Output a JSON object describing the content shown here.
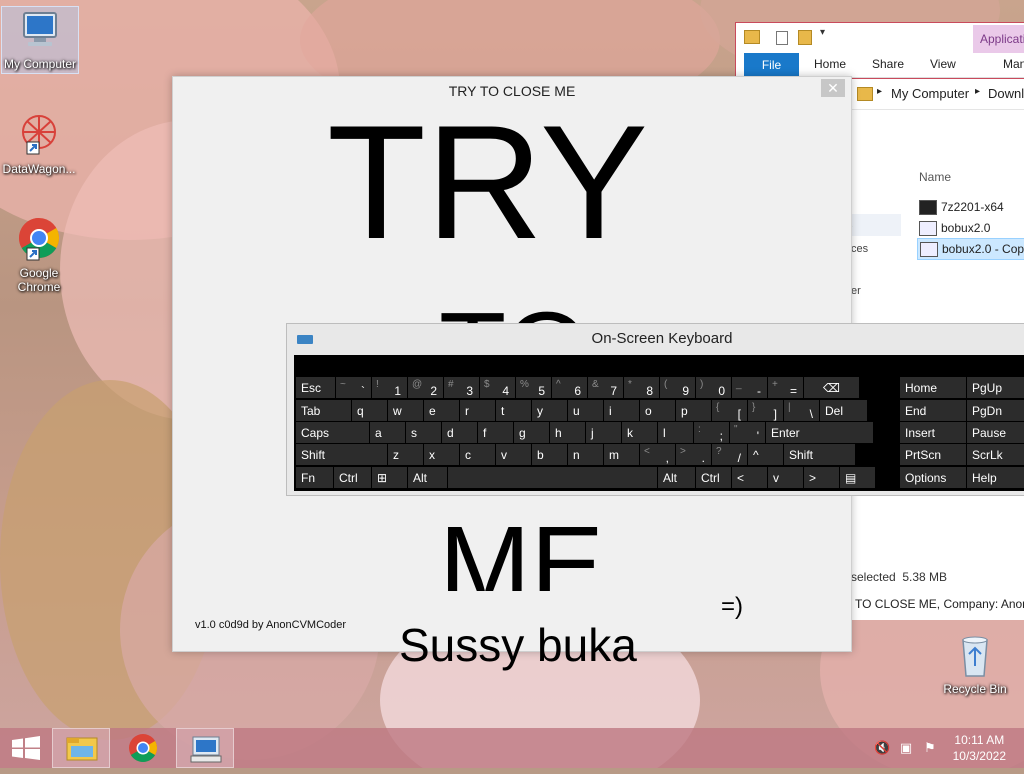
{
  "desktop": {
    "icons": [
      {
        "label": "My Computer",
        "icon": "computer-icon"
      },
      {
        "label": "DataWagon...",
        "icon": "datawagon-icon"
      },
      {
        "label": "Google Chrome",
        "icon": "chrome-icon"
      },
      {
        "label": "Recycle Bin",
        "icon": "recycle-bin-icon"
      }
    ]
  },
  "explorer": {
    "ribbon_tabs": [
      "File",
      "Home",
      "Share",
      "View",
      "Man"
    ],
    "app_tools": "Applicatio",
    "address": [
      "My Computer",
      "Downlo"
    ],
    "column_header": "Name",
    "files": [
      "7z2201-x64",
      "bobux2.0",
      "bobux2.0 - Copy"
    ],
    "nav_fragments": [
      "s",
      "ces",
      "er"
    ],
    "status": "selected  5.38 MB",
    "bottom_text": "TO CLOSE ME, Company: AnonC"
  },
  "prank": {
    "window_title": "TRY TO CLOSE ME",
    "line1": "TRY",
    "line2": "TO",
    "line3": "ME",
    "smiley": "=)",
    "subtitle": "Sussy buka",
    "credit": "v1.0 c0d9d by AnonCVMCoder"
  },
  "osk": {
    "title": "On-Screen Keyboard",
    "row1": [
      {
        "p": "Esc"
      },
      {
        "s": "~",
        "p": "`"
      },
      {
        "s": "!",
        "p": "1"
      },
      {
        "s": "@",
        "p": "2"
      },
      {
        "s": "#",
        "p": "3"
      },
      {
        "s": "$",
        "p": "4"
      },
      {
        "s": "%",
        "p": "5"
      },
      {
        "s": "^",
        "p": "6"
      },
      {
        "s": "&",
        "p": "7"
      },
      {
        "s": "*",
        "p": "8"
      },
      {
        "s": "(",
        "p": "9"
      },
      {
        "s": ")",
        "p": "0"
      },
      {
        "s": "_",
        "p": "-"
      },
      {
        "s": "+",
        "p": "="
      },
      {
        "p": "⌫"
      }
    ],
    "row2": [
      {
        "p": "Tab"
      },
      {
        "p": "q"
      },
      {
        "p": "w"
      },
      {
        "p": "e"
      },
      {
        "p": "r"
      },
      {
        "p": "t"
      },
      {
        "p": "y"
      },
      {
        "p": "u"
      },
      {
        "p": "i"
      },
      {
        "p": "o"
      },
      {
        "p": "p"
      },
      {
        "s": "{",
        "p": "["
      },
      {
        "s": "}",
        "p": "]"
      },
      {
        "s": "|",
        "p": "\\"
      },
      {
        "p": "Del"
      }
    ],
    "row3": [
      {
        "p": "Caps"
      },
      {
        "p": "a"
      },
      {
        "p": "s"
      },
      {
        "p": "d"
      },
      {
        "p": "f"
      },
      {
        "p": "g"
      },
      {
        "p": "h"
      },
      {
        "p": "j"
      },
      {
        "p": "k"
      },
      {
        "p": "l"
      },
      {
        "s": ":",
        "p": ";"
      },
      {
        "s": "\"",
        "p": "'"
      },
      {
        "p": "Enter"
      }
    ],
    "row4": [
      {
        "p": "Shift"
      },
      {
        "p": "z"
      },
      {
        "p": "x"
      },
      {
        "p": "c"
      },
      {
        "p": "v"
      },
      {
        "p": "b"
      },
      {
        "p": "n"
      },
      {
        "p": "m"
      },
      {
        "s": "<",
        "p": ","
      },
      {
        "s": ">",
        "p": "."
      },
      {
        "s": "?",
        "p": "/"
      },
      {
        "p": "^"
      },
      {
        "p": "Shift"
      }
    ],
    "row5": [
      {
        "p": "Fn"
      },
      {
        "p": "Ctrl"
      },
      {
        "p": "⊞"
      },
      {
        "p": "Alt"
      },
      {
        "p": ""
      },
      {
        "p": "Alt"
      },
      {
        "p": "Ctrl"
      },
      {
        "p": "<"
      },
      {
        "p": "v"
      },
      {
        "p": ">"
      },
      {
        "p": "▤"
      }
    ],
    "nav": [
      [
        "Home",
        "PgUp"
      ],
      [
        "End",
        "PgDn"
      ],
      [
        "Insert",
        "Pause"
      ],
      [
        "PrtScn",
        "ScrLk"
      ],
      [
        "Options",
        "Help"
      ]
    ]
  },
  "taskbar": {
    "start": "start-icon",
    "apps": [
      "file-explorer-icon",
      "chrome-icon",
      "on-screen-keyboard-icon"
    ],
    "time": "10:11 AM",
    "date": "10/3/2022"
  }
}
